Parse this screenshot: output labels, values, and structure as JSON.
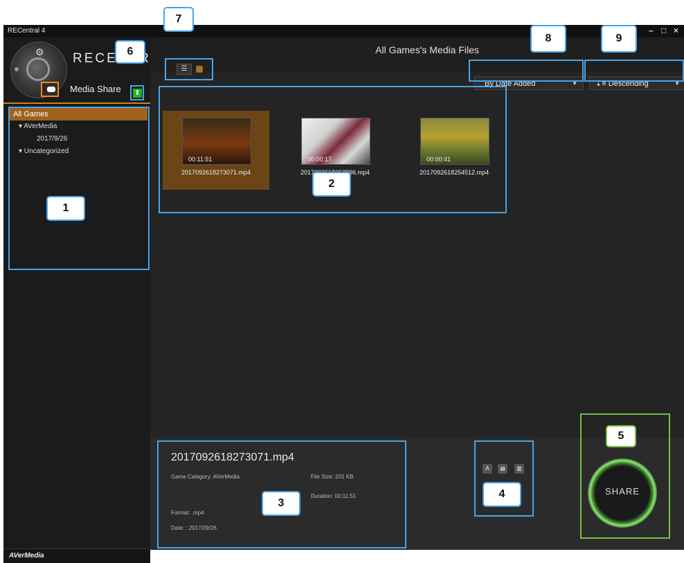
{
  "window": {
    "title": "RECentral 4",
    "minimize": "–",
    "maximize": "□",
    "close": "×"
  },
  "sidebar": {
    "brand": "RECENTRAL",
    "section_label": "Media Share",
    "tree": {
      "all_label": "All Games",
      "groups": [
        {
          "label": "▾ AVerMedia",
          "children": [
            "2017/9/26"
          ]
        },
        {
          "label": "▾ Uncategorized",
          "children": []
        }
      ]
    },
    "footer_brand": "AVerMedia"
  },
  "header": {
    "title": "All Games's Media Files",
    "sort_field": "By Date Added",
    "sort_order": "Descending"
  },
  "files": [
    {
      "name": "2017092618273071.mp4",
      "duration": "00:11:51",
      "selected": true
    },
    {
      "name": "2017092618262996.mp4",
      "duration": "00:00:17",
      "selected": false
    },
    {
      "name": "2017092618254512.mp4",
      "duration": "00:00:41",
      "selected": false
    }
  ],
  "details": {
    "file_name": "2017092618273071.mp4",
    "category": "Game Category: AVerMedia",
    "file_size": "File Size: 201 KB",
    "duration": "Duration: 00:11:51",
    "format": "Format: .mp4",
    "date": "Date: : 2017/09/26"
  },
  "share_button": "SHARE",
  "callouts": {
    "c1": "1",
    "c2": "2",
    "c3": "3",
    "c4": "4",
    "c5": "5",
    "c6": "6",
    "c7": "7",
    "c8": "8",
    "c9": "9"
  },
  "colors": {
    "accent_orange": "#c8871d",
    "annotation_blue": "#4aa3e6",
    "annotation_green": "#76c04b",
    "share_green": "#94e07a"
  }
}
